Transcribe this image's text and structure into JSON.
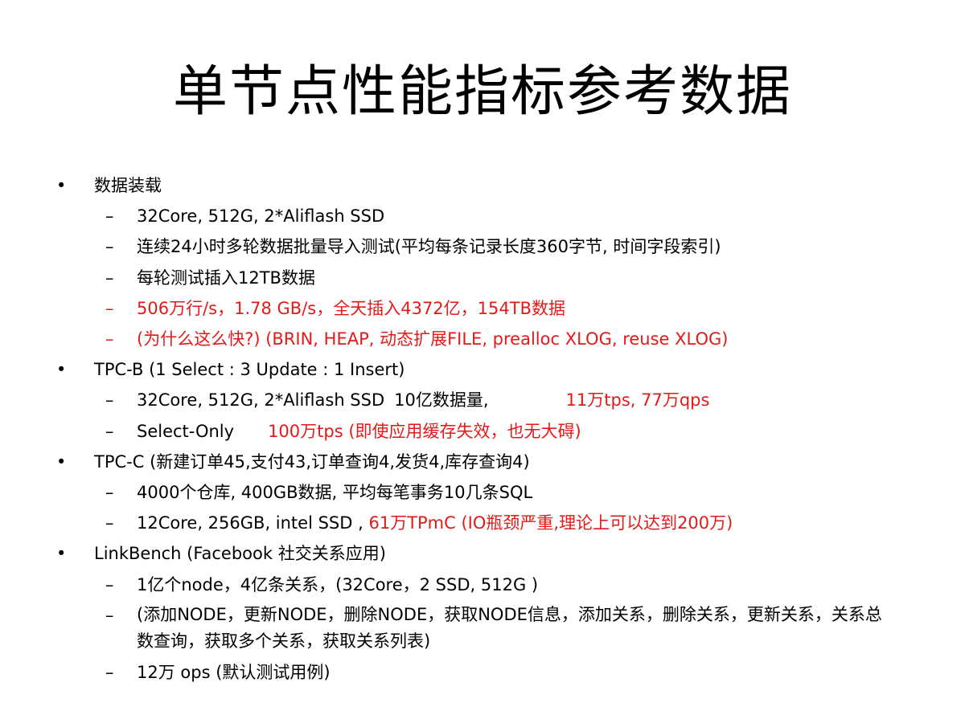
{
  "title": "单节点性能指标参考数据",
  "bullet_glyph": "•",
  "dash_glyph": "–",
  "colors": {
    "text": "#000000",
    "highlight": "#e41a1a",
    "background": "#ffffff"
  },
  "sections": [
    {
      "heading": "数据装载",
      "items": [
        "32Core, 512G, 2*Aliflash SSD",
        "连续24小时多轮数据批量导入测试(平均每条记录长度360字节, 时间字段索引)",
        "每轮测试插入12TB数据",
        "506万行/s，1.78 GB/s，全天插入4372亿，154TB数据",
        "(为什么这么快?)  (BRIN, HEAP, 动态扩展FILE, prealloc XLOG, reuse XLOG)"
      ]
    },
    {
      "heading": "TPC-B (1 Select : 3 Update : 1 Insert)",
      "items": [
        {
          "main": "32Core, 512G, 2*Aliflash SSD",
          "extra": "10亿数据量,",
          "red": "11万tps, 77万qps"
        },
        {
          "main": "Select-Only",
          "red": "100万tps  (即使应用缓存失效，也无大碍)"
        }
      ]
    },
    {
      "heading": "TPC-C (新建订单45,支付43,订单查询4,发货4,库存查询4)",
      "items": [
        "4000个仓库, 400GB数据, 平均每笔事务10几条SQL",
        {
          "main": "12Core, 256GB, intel SSD ,",
          "red": "61万TPmC  (IO瓶颈严重,理论上可以达到200万)"
        }
      ]
    },
    {
      "heading": "LinkBench (Facebook 社交关系应用)",
      "items": [
        "1亿个node，4亿条关系，(32Core，2 SSD, 512G )",
        "(添加NODE，更新NODE，删除NODE，获取NODE信息，添加关系，删除关系，更新关系，关系总数查询，获取多个关系，获取关系列表)",
        "12万 ops  (默认测试用例)"
      ]
    }
  ]
}
